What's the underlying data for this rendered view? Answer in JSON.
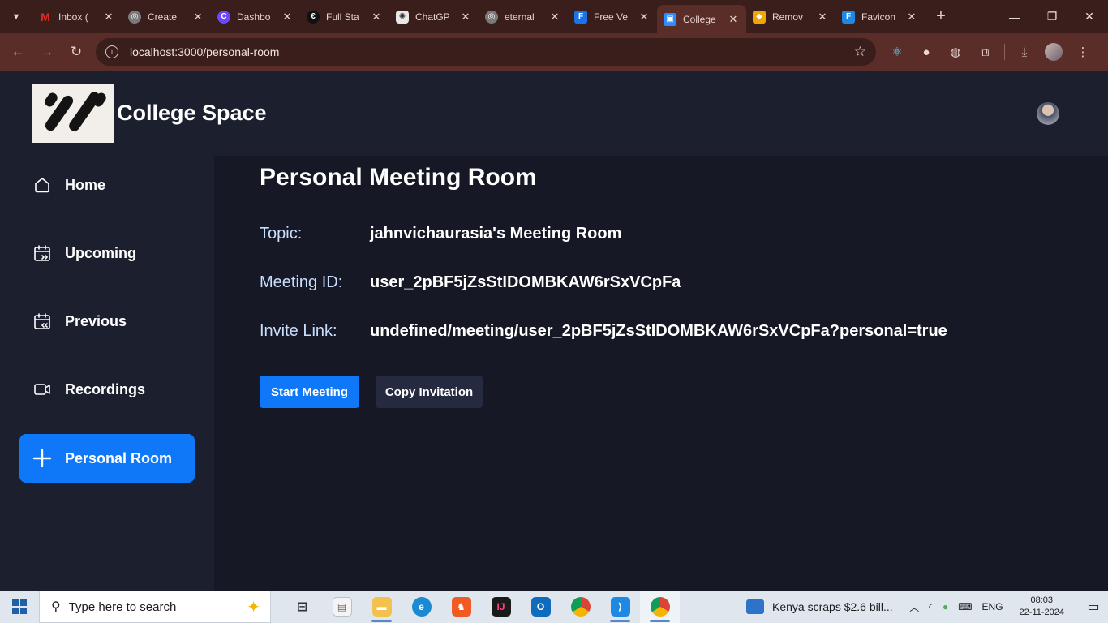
{
  "browser": {
    "tabs": [
      {
        "title": "Inbox (",
        "favicon": "gmail-icon",
        "color": "#d93025",
        "glyph": "M"
      },
      {
        "title": "Create",
        "favicon": "globe-icon",
        "color": "#7a7a7a",
        "glyph": "◎"
      },
      {
        "title": "Dashbo",
        "favicon": "clerk-icon",
        "color": "#6c47ff",
        "glyph": "C"
      },
      {
        "title": "Full Sta",
        "favicon": "cursor-icon",
        "color": "#111111",
        "glyph": "€"
      },
      {
        "title": "ChatGP",
        "favicon": "chatgpt-icon",
        "color": "#444444",
        "glyph": "✺"
      },
      {
        "title": "eternal",
        "favicon": "globe-icon",
        "color": "#7a7a7a",
        "glyph": "◎"
      },
      {
        "title": "Free Ve",
        "favicon": "forms-icon",
        "color": "#1a73e8",
        "glyph": "F"
      },
      {
        "title": "College",
        "favicon": "zoom-icon",
        "color": "#2d8cff",
        "glyph": "▣",
        "active": true
      },
      {
        "title": "Remov",
        "favicon": "remove-bg-icon",
        "color": "#f0a500",
        "glyph": "◆"
      },
      {
        "title": "Favicon",
        "favicon": "favicon-io-icon",
        "color": "#1e88e5",
        "glyph": "F"
      }
    ],
    "url": "localhost:3000/personal-room"
  },
  "app": {
    "title": "College Space"
  },
  "sidebar": {
    "items": [
      {
        "label": "Home",
        "icon": "home-icon"
      },
      {
        "label": "Upcoming",
        "icon": "calendar-forward-icon"
      },
      {
        "label": "Previous",
        "icon": "calendar-back-icon"
      },
      {
        "label": "Recordings",
        "icon": "video-icon"
      },
      {
        "label": "Personal Room",
        "icon": "plus-icon",
        "active": true
      }
    ]
  },
  "main": {
    "title": "Personal Meeting Room",
    "details": [
      {
        "label": "Topic:",
        "value": "jahnvichaurasia's Meeting Room"
      },
      {
        "label": "Meeting ID:",
        "value": "user_2pBF5jZsStIDOMBKAW6rSxVCpFa"
      },
      {
        "label": "Invite Link:",
        "value": "undefined/meeting/user_2pBF5jZsStIDOMBKAW6rSxVCpFa?personal=true"
      }
    ],
    "start_button": "Start Meeting",
    "copy_button": "Copy Invitation"
  },
  "colors": {
    "accent": "#0e78f9",
    "sidebar_bg": "#1c1f2e",
    "main_bg": "#161925",
    "label_color": "#c9ddff"
  },
  "taskbar": {
    "search_placeholder": "Type here to search",
    "news": "Kenya scraps $2.6 bill...",
    "language": "ENG",
    "time": "08:03",
    "date": "22-11-2024"
  }
}
